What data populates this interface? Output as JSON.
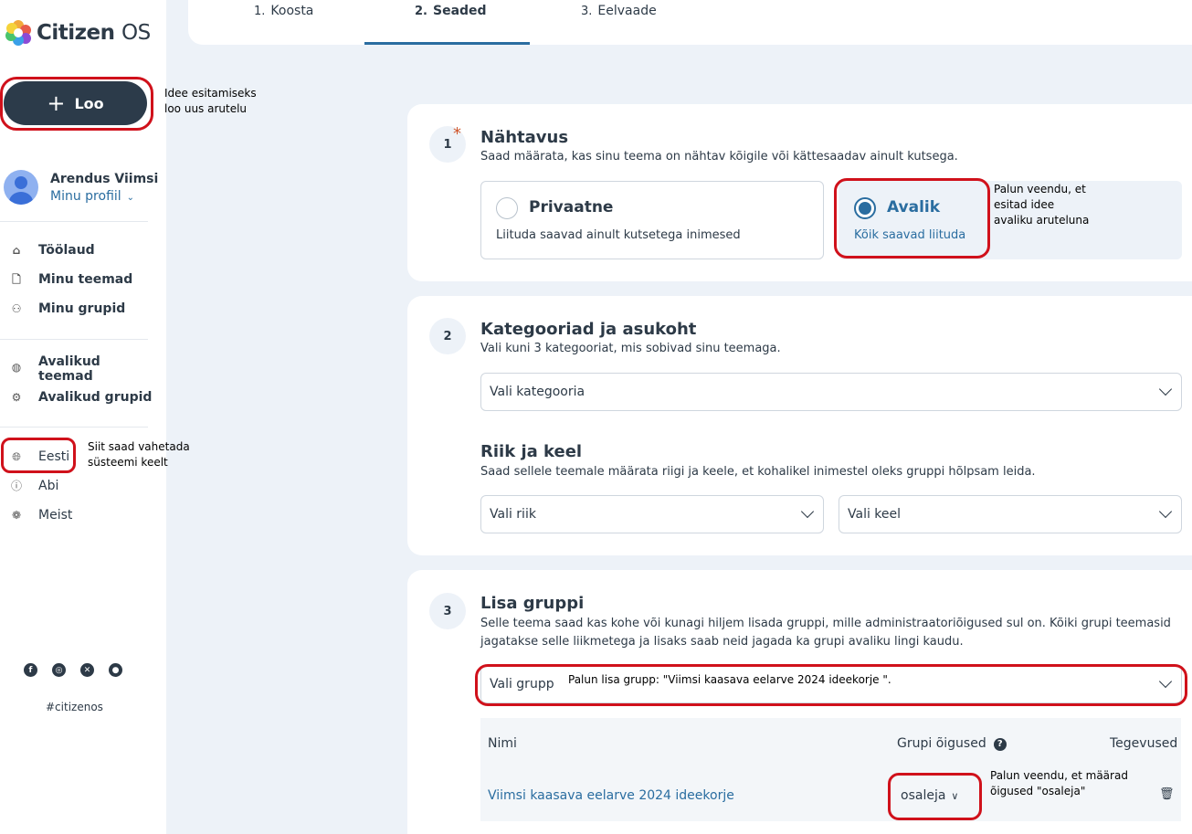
{
  "brand": {
    "name": "Citizen",
    "suffix": "OS"
  },
  "sidebar": {
    "create_label": "Loo",
    "create_note": [
      "Idee esitamiseks",
      "loo uus arutelu"
    ],
    "profile": {
      "name": "Arendus Viimsi",
      "link": "Minu profiil"
    },
    "nav_main": [
      {
        "label": "Töölaud",
        "icon": "home-icon"
      },
      {
        "label": "Minu teemad",
        "icon": "document-icon"
      },
      {
        "label": "Minu grupid",
        "icon": "users-icon"
      }
    ],
    "nav_public": [
      {
        "label": "Avalikud teemad",
        "icon": "globe-icon"
      },
      {
        "label": "Avalikud grupid",
        "icon": "groups-icon"
      }
    ],
    "nav_footer": [
      {
        "label": "Eesti",
        "icon": "language-icon"
      },
      {
        "label": "Abi",
        "icon": "help-icon"
      },
      {
        "label": "Meist",
        "icon": "about-icon"
      }
    ],
    "language_note": [
      "Siit saad vahetada",
      "süsteemi keelt"
    ],
    "socials": [
      "facebook-icon",
      "instagram-icon",
      "x-icon",
      "github-icon"
    ],
    "hashtag": "#citizenos"
  },
  "tabs": [
    {
      "num": "1.",
      "label": "Koosta"
    },
    {
      "num": "2.",
      "label": "Seaded"
    },
    {
      "num": "3.",
      "label": "Eelvaade"
    }
  ],
  "visibility": {
    "step": "1",
    "title": "Nähtavus",
    "desc": "Saad määrata, kas sinu teema on nähtav kõigile või kättesaadav ainult kutsega.",
    "private": {
      "title": "Privaatne",
      "desc": "Liituda saavad ainult kutsetega inimesed"
    },
    "public": {
      "title": "Avalik",
      "desc": "Kõik saavad liituda"
    },
    "note": [
      "Palun veendu, et",
      "esitad idee",
      "avaliku aruteluna"
    ]
  },
  "categories": {
    "step": "2",
    "title": "Kategooriad ja asukoht",
    "desc": "Vali kuni 3 kategooriat, mis sobivad sinu teemaga.",
    "select_label": "Vali kategooria",
    "country_title": "Riik ja keel",
    "country_desc": "Saad sellele teemale määrata riigi ja keele, et kohalikel inimestel oleks gruppi hõlpsam leida.",
    "country_select": "Vali riik",
    "language_select": "Vali keel"
  },
  "groups": {
    "step": "3",
    "title": "Lisa gruppi",
    "desc": [
      "Selle teema saad kas kohe või kunagi hiljem lisada gruppi, mille administraatoriõigused sul on. Kõiki grupi teemasid",
      "jagatakse selle liikmetega ja lisaks saab neid jagada ka grupi avaliku lingi kaudu."
    ],
    "select_label": "Vali grupp",
    "select_note": "Palun lisa grupp: \"Viimsi kaasava eelarve 2024 ideekorje \".",
    "columns": {
      "name": "Nimi",
      "rights": "Grupi õigused",
      "actions": "Tegevused"
    },
    "row": {
      "name": "Viimsi kaasava eelarve 2024 ideekorje",
      "role": "osaleja"
    },
    "role_note": [
      "Palun veendu, et määrad",
      "õigused \"osaleja\""
    ]
  },
  "colors": {
    "accent": "#2a6da0",
    "dark": "#2c3b4a",
    "highlight": "#d0111b"
  }
}
